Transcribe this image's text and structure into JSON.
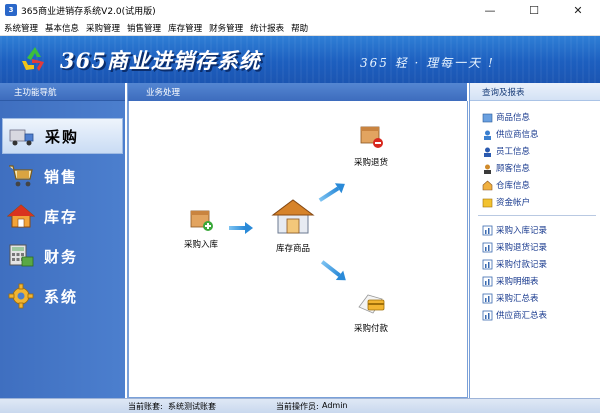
{
  "window": {
    "title": "365商业进销存系统V2.0(试用版)",
    "minimize": "—",
    "maximize": "☐",
    "close": "✕"
  },
  "menu": [
    "系统管理",
    "基本信息",
    "采购管理",
    "销售管理",
    "库存管理",
    "财务管理",
    "统计报表",
    "帮助"
  ],
  "banner": {
    "title": "365商业进销存系统",
    "slogan": "365 轻 · 理每一天 !"
  },
  "sidebar": {
    "header": "主功能导航",
    "items": [
      {
        "label": "采购",
        "icon": "truck-icon",
        "active": true
      },
      {
        "label": "销售",
        "icon": "cart-icon",
        "active": false
      },
      {
        "label": "库存",
        "icon": "house-icon",
        "active": false
      },
      {
        "label": "财务",
        "icon": "calculator-icon",
        "active": false
      },
      {
        "label": "系统",
        "icon": "gear-icon",
        "active": false
      }
    ]
  },
  "main": {
    "header": "业务处理",
    "nodes": {
      "purchase_in": "采购入库",
      "inventory": "库存商品",
      "purchase_return": "采购退货",
      "purchase_pay": "采购付款"
    }
  },
  "right": {
    "header": "查询及报表",
    "group1": [
      {
        "label": "商品信息",
        "icon": "goods-icon"
      },
      {
        "label": "供应商信息",
        "icon": "supplier-icon"
      },
      {
        "label": "员工信息",
        "icon": "employee-icon"
      },
      {
        "label": "顾客信息",
        "icon": "customer-icon"
      },
      {
        "label": "仓库信息",
        "icon": "warehouse-icon"
      },
      {
        "label": "资金帐户",
        "icon": "account-icon"
      }
    ],
    "group2": [
      {
        "label": "采购入库记录",
        "icon": "report-icon"
      },
      {
        "label": "采购退货记录",
        "icon": "report-icon"
      },
      {
        "label": "采购付款记录",
        "icon": "report-icon"
      },
      {
        "label": "采购明细表",
        "icon": "report-icon"
      },
      {
        "label": "采购汇总表",
        "icon": "report-icon"
      },
      {
        "label": "供应商汇总表",
        "icon": "report-icon"
      }
    ]
  },
  "status": {
    "account_label": "当前账套:",
    "account_value": "系统测试账套",
    "operator_label": "当前操作员:",
    "operator_value": "Admin"
  }
}
